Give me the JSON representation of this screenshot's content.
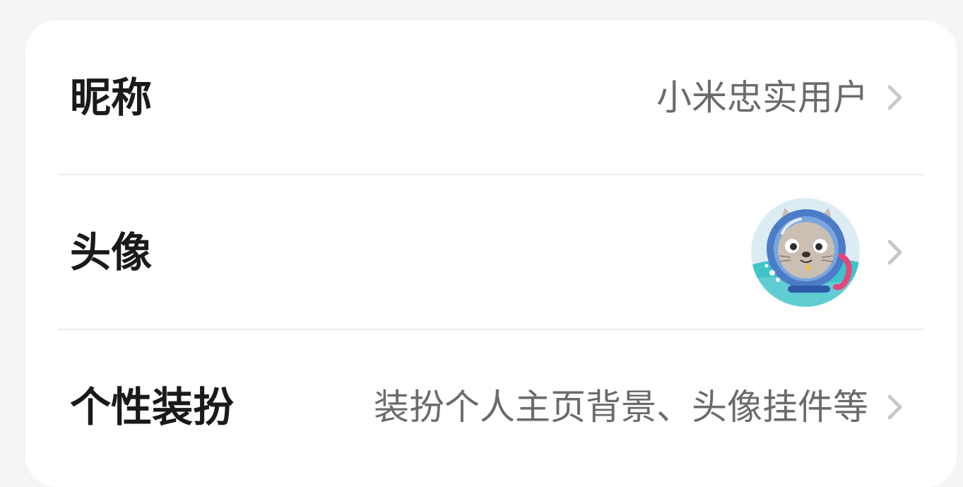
{
  "rows": [
    {
      "label": "昵称",
      "value": "小米忠实用户",
      "chevron_icon": "chevron-right-icon"
    },
    {
      "label": "头像",
      "avatar_icon": "cat-astronaut-avatar",
      "chevron_icon": "chevron-right-icon"
    },
    {
      "label": "个性装扮",
      "value": "装扮个人主页背景、头像挂件等",
      "chevron_icon": "chevron-right-icon"
    }
  ],
  "colors": {
    "page_background": "#f5f5f5",
    "card_background": "#ffffff",
    "label_text": "#1a1a1a",
    "value_text": "#6b6b6b",
    "chevron": "#c8c8c8",
    "divider": "#ececec"
  }
}
